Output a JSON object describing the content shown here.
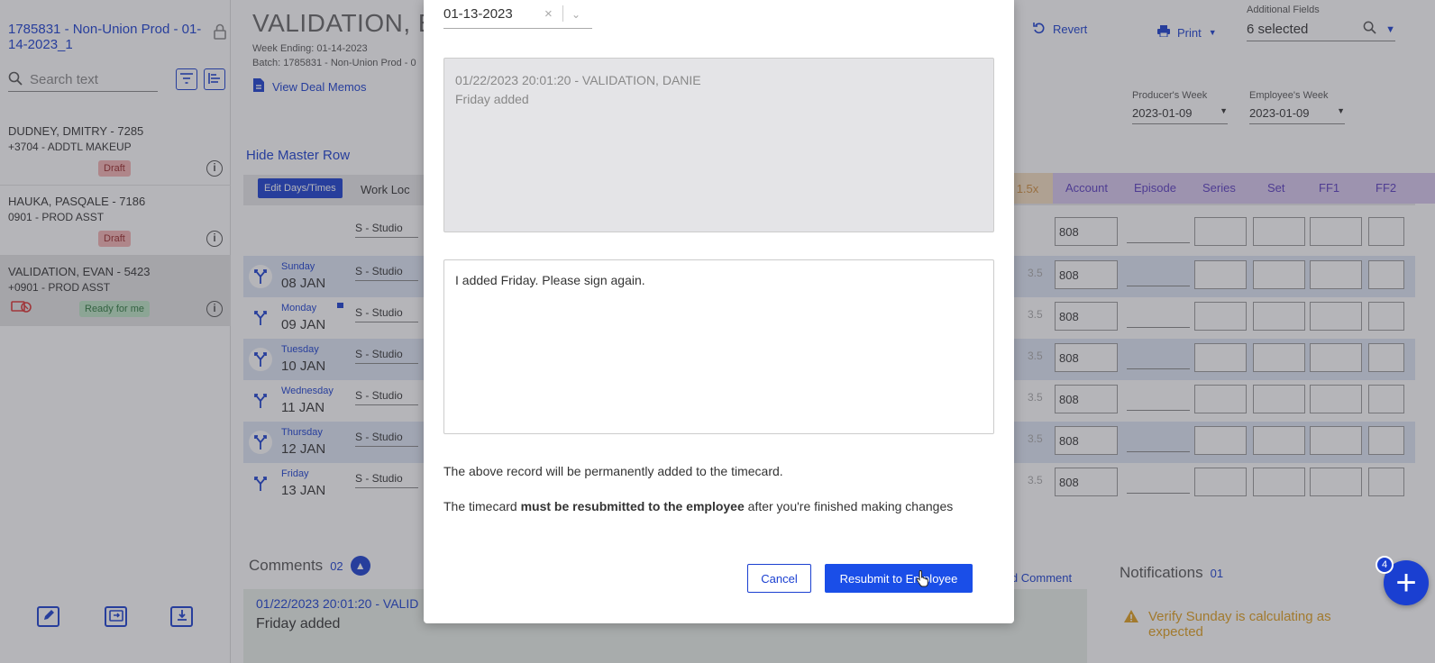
{
  "sidebar": {
    "title": "1785831 - Non-Union Prod - 01-14-2023_1",
    "search_placeholder": "Search text",
    "employees": [
      {
        "name": "DUDNEY, DMITRY - 7285",
        "role": "+3704 - ADDTL MAKEUP",
        "status": "Draft"
      },
      {
        "name": "HAUKA, PASQALE - 7186",
        "role": "0901 - PROD ASST",
        "status": "Draft"
      },
      {
        "name": "VALIDATION, EVAN - 5423",
        "role": "+0901 - PROD ASST",
        "status": "Ready for me"
      }
    ]
  },
  "main": {
    "title": "VALIDATION, E",
    "week_ending": "Week Ending: 01-14-2023",
    "batch": "Batch: 1785831 - Non-Union Prod - 0",
    "deal_memos": "View Deal Memos",
    "hide_master": "Hide Master Row",
    "edit_days": "Edit Days/Times",
    "work_loc": "Work Loc",
    "revert": "Revert",
    "print": "Print",
    "additional_fields_label": "Additional Fields",
    "additional_fields_value": "6 selected",
    "producers_week_label": "Producer's Week",
    "producers_week_value": "2023-01-09",
    "employees_week_label": "Employee's Week",
    "employees_week_value": "2023-01-09",
    "rate_header": "1.5x",
    "columns": [
      "Account",
      "Episode",
      "Series",
      "Set",
      "FF1",
      "FF2"
    ],
    "master_row": {
      "location": "S - Studio",
      "account": "808"
    },
    "rows": [
      {
        "day": "Sunday",
        "date": "08 JAN",
        "location": "S - Studio",
        "rate": "3.5",
        "account": "808"
      },
      {
        "day": "Monday",
        "date": "09 JAN",
        "location": "S - Studio",
        "rate": "3.5",
        "account": "808"
      },
      {
        "day": "Tuesday",
        "date": "10 JAN",
        "location": "S - Studio",
        "rate": "3.5",
        "account": "808"
      },
      {
        "day": "Wednesday",
        "date": "11 JAN",
        "location": "S - Studio",
        "rate": "3.5",
        "account": "808"
      },
      {
        "day": "Thursday",
        "date": "12 JAN",
        "location": "S - Studio",
        "rate": "3.5",
        "account": "808"
      },
      {
        "day": "Friday",
        "date": "13 JAN",
        "location": "S - Studio",
        "rate": "3.5",
        "account": "808"
      }
    ],
    "comments_label": "Comments",
    "comments_count": "02",
    "comment_header": "01/22/2023 20:01:20 - VALID",
    "comment_text": "Friday added",
    "add_comment": "Add Comment",
    "notifications_label": "Notifications",
    "notifications_count": "01",
    "notification_text": "Verify Sunday is calculating as expected",
    "fab_badge": "4",
    "fab_label": "+"
  },
  "modal": {
    "date_value": "01-13-2023",
    "clear_label": "×",
    "history_header": "01/22/2023 20:01:20 - VALIDATION, DANIE",
    "history_text": "Friday added",
    "comment_value": "I added Friday. Please sign again.",
    "note1": "The above record will be permanently added to the timecard.",
    "note2_pre": "The timecard ",
    "note2_bold": "must be resubmitted to the employee",
    "note2_post": " after you're finished making changes",
    "cancel_label": "Cancel",
    "resubmit_label": "Resubmit to Employee"
  },
  "colors": {
    "accent": "#1a3fd1",
    "draft_badge": "#f6b3b3",
    "ready_badge": "#bde5c5",
    "column_header_bg": "#d8c8ef"
  }
}
